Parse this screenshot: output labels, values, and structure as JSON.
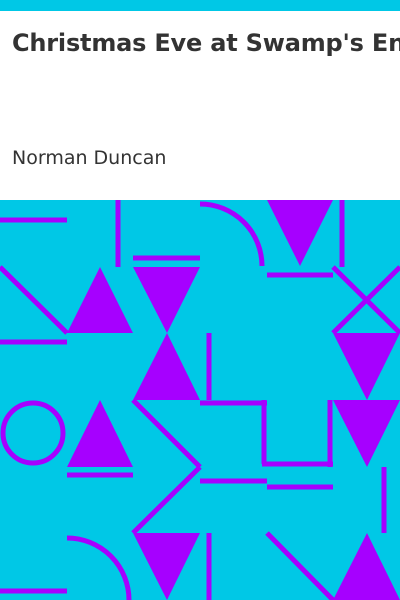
{
  "book": {
    "title": "Christmas Eve at Swamp's End",
    "author": "Norman Duncan"
  },
  "colors": {
    "accent_band": "#00c8e6",
    "pattern_background": "#00c8e6",
    "pattern_foreground": "#a600ff",
    "text": "#333333",
    "title_background": "#ffffff"
  }
}
